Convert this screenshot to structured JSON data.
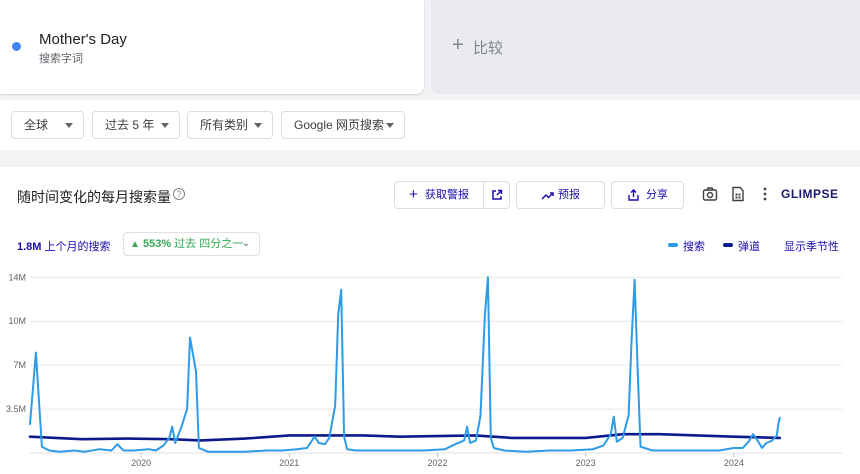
{
  "term": {
    "name": "Mother's Day",
    "type": "搜索字词",
    "color": "#4285f4"
  },
  "compare": {
    "plus": "+",
    "label": "比较"
  },
  "filters": [
    {
      "label": "全球"
    },
    {
      "label": "过去 5 年"
    },
    {
      "label": "所有类别"
    },
    {
      "label": "Google 网页搜索"
    }
  ],
  "panel": {
    "title": "随时间变化的每月搜索量",
    "help": "?",
    "alert_button": "获取警报",
    "forecast_button": "预报",
    "share_button": "分享",
    "brand": "GLIMPSE"
  },
  "stats": {
    "value": "1.8M",
    "value_label": "上个月的搜索",
    "change_arrow": "▲",
    "change": "553%",
    "change_label": "过去 四分之一",
    "chevron": "⌄"
  },
  "legend": {
    "search": "搜索",
    "trend": "弹道",
    "seasonality": "显示季节性",
    "search_color": "#2e9be6",
    "trend_color": "#0d1a8c"
  },
  "chart_data": {
    "type": "line",
    "x_labels": [
      "2020",
      "2021",
      "2022",
      "2023",
      "2024"
    ],
    "y_tick_labels": [
      "14M",
      "10M",
      "7M",
      "3.5M"
    ],
    "y_ticks": [
      14,
      10.5,
      7,
      3.5
    ],
    "ylim": [
      0,
      14.5
    ],
    "xlim": [
      2019.25,
      2024.73
    ],
    "grid": true,
    "series": [
      {
        "name": "搜索",
        "color": "#2e9be6",
        "points": [
          [
            2019.25,
            2.3
          ],
          [
            2019.29,
            8.0
          ],
          [
            2019.33,
            0.5
          ],
          [
            2019.38,
            0.2
          ],
          [
            2019.45,
            0.1
          ],
          [
            2019.55,
            0.2
          ],
          [
            2019.62,
            0.1
          ],
          [
            2019.72,
            0.3
          ],
          [
            2019.8,
            0.2
          ],
          [
            2019.84,
            0.7
          ],
          [
            2019.88,
            0.2
          ],
          [
            2019.95,
            0.2
          ],
          [
            2020.05,
            0.3
          ],
          [
            2020.1,
            0.2
          ],
          [
            2020.15,
            0.6
          ],
          [
            2020.19,
            1.2
          ],
          [
            2020.21,
            2.1
          ],
          [
            2020.23,
            0.8
          ],
          [
            2020.27,
            2.0
          ],
          [
            2020.31,
            3.5
          ],
          [
            2020.33,
            9.2
          ],
          [
            2020.37,
            6.5
          ],
          [
            2020.39,
            0.4
          ],
          [
            2020.45,
            0.1
          ],
          [
            2020.55,
            0.1
          ],
          [
            2020.7,
            0.1
          ],
          [
            2020.85,
            0.2
          ],
          [
            2020.95,
            0.2
          ],
          [
            2021.05,
            0.3
          ],
          [
            2021.12,
            0.4
          ],
          [
            2021.17,
            1.3
          ],
          [
            2021.2,
            0.8
          ],
          [
            2021.24,
            0.7
          ],
          [
            2021.27,
            1.2
          ],
          [
            2021.31,
            3.8
          ],
          [
            2021.33,
            11.0
          ],
          [
            2021.35,
            13.0
          ],
          [
            2021.37,
            1.3
          ],
          [
            2021.39,
            0.3
          ],
          [
            2021.45,
            0.2
          ],
          [
            2021.6,
            0.2
          ],
          [
            2021.75,
            0.2
          ],
          [
            2021.9,
            0.2
          ],
          [
            2022.05,
            0.3
          ],
          [
            2022.12,
            0.7
          ],
          [
            2022.18,
            1.0
          ],
          [
            2022.2,
            2.1
          ],
          [
            2022.22,
            0.8
          ],
          [
            2022.26,
            1.0
          ],
          [
            2022.29,
            3.0
          ],
          [
            2022.32,
            11.0
          ],
          [
            2022.34,
            14.0
          ],
          [
            2022.36,
            1.2
          ],
          [
            2022.38,
            0.4
          ],
          [
            2022.45,
            0.2
          ],
          [
            2022.6,
            0.1
          ],
          [
            2022.75,
            0.2
          ],
          [
            2022.9,
            0.2
          ],
          [
            2023.05,
            0.3
          ],
          [
            2023.12,
            0.6
          ],
          [
            2023.17,
            1.5
          ],
          [
            2023.19,
            2.9
          ],
          [
            2023.21,
            0.9
          ],
          [
            2023.25,
            1.2
          ],
          [
            2023.29,
            3.0
          ],
          [
            2023.31,
            9.0
          ],
          [
            2023.33,
            13.8
          ],
          [
            2023.35,
            7.0
          ],
          [
            2023.37,
            0.5
          ],
          [
            2023.45,
            0.2
          ],
          [
            2023.6,
            0.2
          ],
          [
            2023.75,
            0.2
          ],
          [
            2023.9,
            0.2
          ],
          [
            2024.0,
            0.4
          ],
          [
            2024.06,
            0.4
          ],
          [
            2024.1,
            0.9
          ],
          [
            2024.13,
            1.5
          ],
          [
            2024.16,
            1.0
          ],
          [
            2024.19,
            0.4
          ],
          [
            2024.22,
            0.8
          ],
          [
            2024.26,
            1.0
          ],
          [
            2024.29,
            1.4
          ],
          [
            2024.3,
            2.3
          ],
          [
            2024.31,
            2.8
          ]
        ]
      },
      {
        "name": "弹道",
        "color": "#0d1a8c",
        "points": [
          [
            2019.25,
            1.3
          ],
          [
            2019.6,
            1.1
          ],
          [
            2019.9,
            1.15
          ],
          [
            2020.2,
            1.1
          ],
          [
            2020.4,
            1.0
          ],
          [
            2020.7,
            1.15
          ],
          [
            2021.0,
            1.4
          ],
          [
            2021.25,
            1.4
          ],
          [
            2021.5,
            1.4
          ],
          [
            2021.75,
            1.3
          ],
          [
            2022.0,
            1.35
          ],
          [
            2022.25,
            1.4
          ],
          [
            2022.5,
            1.2
          ],
          [
            2022.8,
            1.2
          ],
          [
            2023.0,
            1.2
          ],
          [
            2023.25,
            1.5
          ],
          [
            2023.5,
            1.5
          ],
          [
            2023.75,
            1.4
          ],
          [
            2024.0,
            1.3
          ],
          [
            2024.31,
            1.2
          ]
        ]
      }
    ]
  }
}
